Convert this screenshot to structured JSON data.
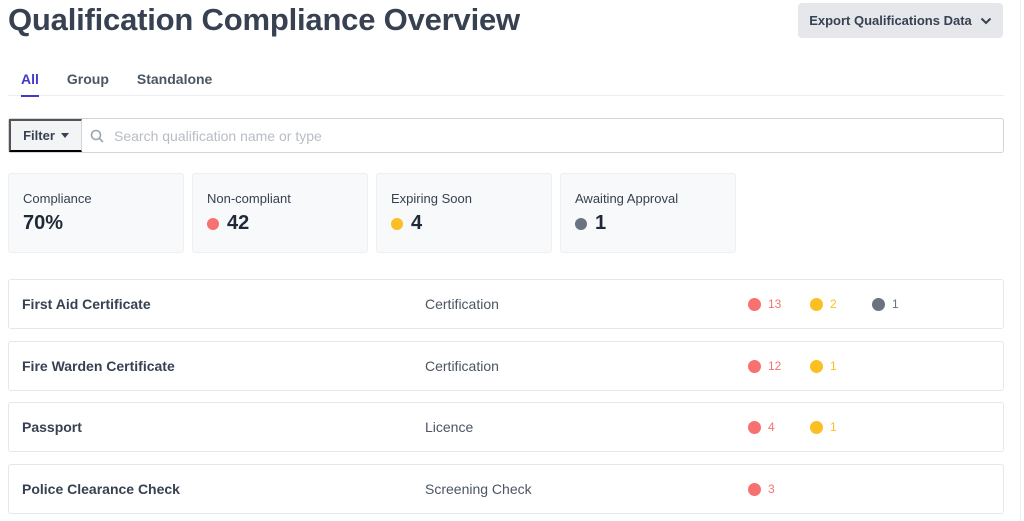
{
  "header": {
    "title": "Qualification Compliance Overview",
    "export_label": "Export Qualifications Data"
  },
  "tabs": [
    {
      "label": "All",
      "active": true
    },
    {
      "label": "Group"
    },
    {
      "label": "Standalone"
    }
  ],
  "toolbar": {
    "filter_label": "Filter",
    "search_placeholder": "Search qualification name or type",
    "search_value": ""
  },
  "colors": {
    "red": "#f87171",
    "amber": "#fbbf24",
    "gray": "#6b7280",
    "accent": "#4338ca"
  },
  "stats": [
    {
      "label": "Compliance",
      "value": "70%"
    },
    {
      "label": "Non-compliant",
      "value": "42"
    },
    {
      "label": "Expiring Soon",
      "value": "4"
    },
    {
      "label": "Awaiting Approval",
      "value": "1"
    }
  ],
  "rows": [
    {
      "name": "First Aid Certificate",
      "type": "Certification",
      "noncompliant": "13",
      "expiring": "2",
      "awaiting": "1"
    },
    {
      "name": "Fire Warden Certificate",
      "type": "Certification",
      "noncompliant": "12",
      "expiring": "1"
    },
    {
      "name": "Passport",
      "type": "Licence",
      "noncompliant": "4",
      "expiring": "1"
    },
    {
      "name": "Police Clearance Check",
      "type": "Screening Check",
      "noncompliant": "3"
    }
  ]
}
